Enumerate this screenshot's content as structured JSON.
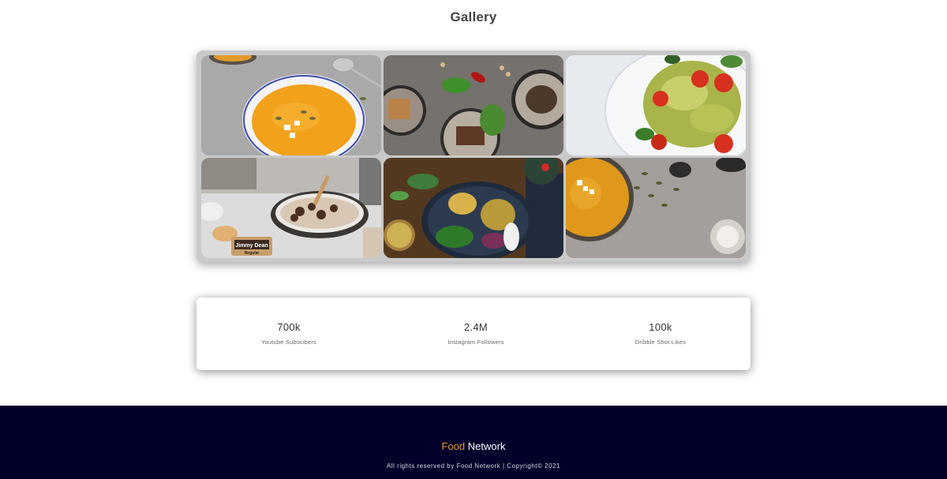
{
  "gallery": {
    "title": "Gallery",
    "tiles": [
      {
        "name": "pumpkin-soup-bowl"
      },
      {
        "name": "steak-salad-plates"
      },
      {
        "name": "bowtie-pasta-salad"
      },
      {
        "name": "sausage-skillet",
        "label_text": "Jimmy Dean"
      },
      {
        "name": "buddha-bowl"
      },
      {
        "name": "soup-bowl-seeds"
      }
    ]
  },
  "stats": [
    {
      "value": "700k",
      "label": "Youtube Subscibers"
    },
    {
      "value": "2.4M",
      "label": "Instagram Followers"
    },
    {
      "value": "100k",
      "label": "Dribble Shot Likes"
    }
  ],
  "footer": {
    "brand_accent": "Food",
    "brand_rest": " Network",
    "copyright": "All rights reserved by Food Network | Copyright© 2021"
  },
  "colors": {
    "footer_bg": "#02002a",
    "accent": "#e8962a"
  }
}
